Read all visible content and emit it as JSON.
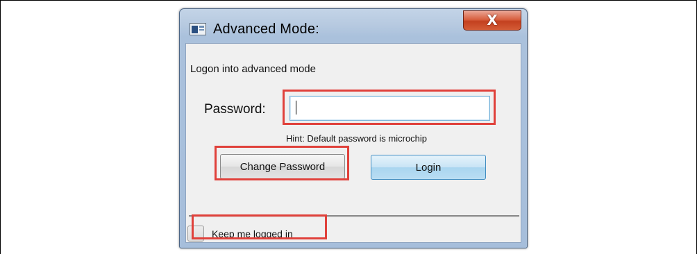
{
  "window": {
    "title": "Advanced Mode:",
    "close_label": "X"
  },
  "header": {
    "text": "Logon into advanced mode"
  },
  "password": {
    "label": "Password:",
    "value": "",
    "placeholder": "",
    "hint": "Hint: Default password is microchip"
  },
  "buttons": {
    "change_password": "Change Password",
    "login": "Login"
  },
  "keep_logged_in": {
    "label": "Keep me logged in",
    "checked": false
  },
  "colors": {
    "highlight": "#e0413b",
    "close_button": "#c3401f",
    "login_button": "#a9d5ef",
    "title_bar": "#b6c9e0"
  }
}
